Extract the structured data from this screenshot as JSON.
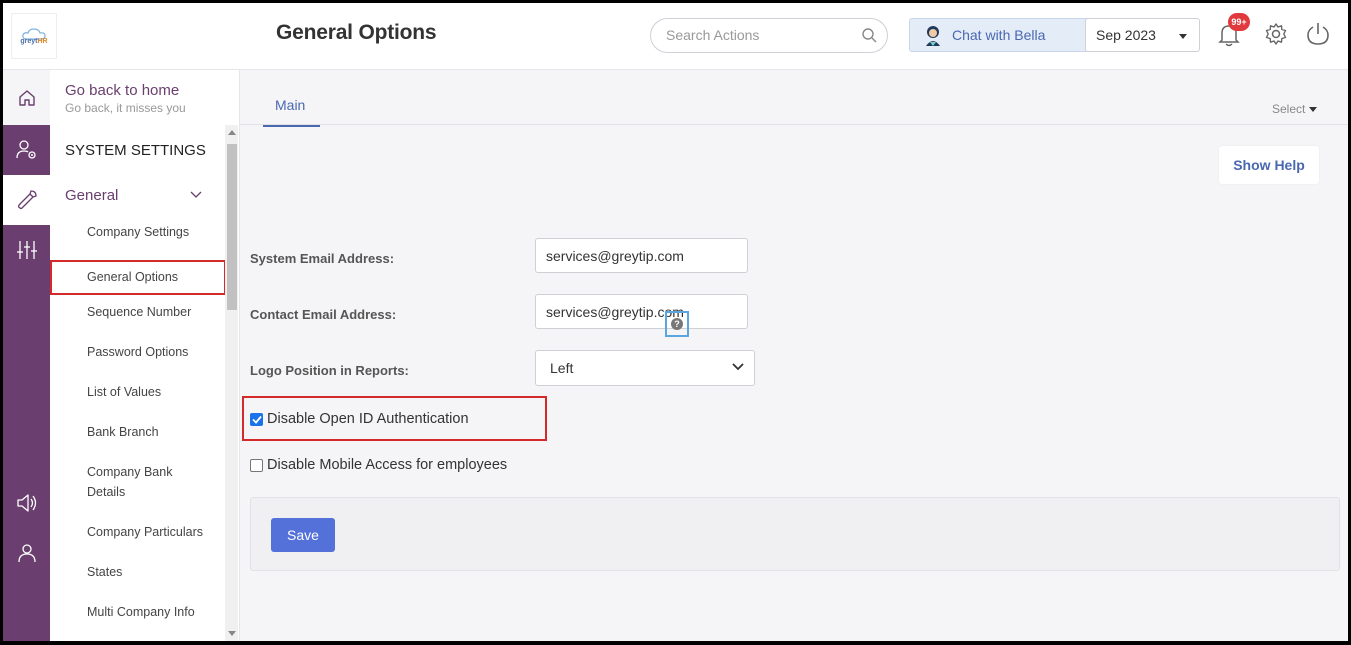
{
  "header": {
    "logo_text_a": "greyt",
    "logo_text_b": "HR",
    "title": "General Options",
    "search_placeholder": "Search Actions",
    "chat_label": "Chat with Bella",
    "month_value": "Sep 2023",
    "notification_badge": "99+"
  },
  "rail": {
    "items": [
      "home-icon",
      "user-settings-icon",
      "wrench-icon",
      "sliders-icon",
      "announcement-icon",
      "profile-icon"
    ]
  },
  "subnav": {
    "goback_title": "Go back to home",
    "goback_sub": "Go back, it misses you",
    "section_title": "SYSTEM SETTINGS",
    "group_title": "General",
    "items": [
      "Company Settings",
      "General Options",
      "Sequence Number",
      "Password Options",
      "List of Values",
      "Bank Branch",
      "Company Bank Details",
      "Company Particulars",
      "States",
      "Multi Company Info"
    ],
    "selected_item": "General Options"
  },
  "main": {
    "tab_main": "Main",
    "select_label": "Select",
    "show_help": "Show Help",
    "system_email_label": "System Email Address:",
    "system_email_value": "services@greytip.com",
    "contact_email_label": "Contact Email Address:",
    "contact_email_value": "services@greytip.com",
    "help_glyph": "?",
    "logo_position_label": "Logo Position in Reports:",
    "logo_position_value": "Left",
    "disable_openid_label": "Disable Open ID Authentication",
    "disable_openid_checked": true,
    "disable_mobile_label": "Disable Mobile Access for employees",
    "disable_mobile_checked": false,
    "save_label": "Save"
  },
  "colors": {
    "rail_bg": "#6a3e6e",
    "accent": "#4a68b0",
    "save_bg": "#5470d9",
    "highlight": "#d42a2a"
  }
}
